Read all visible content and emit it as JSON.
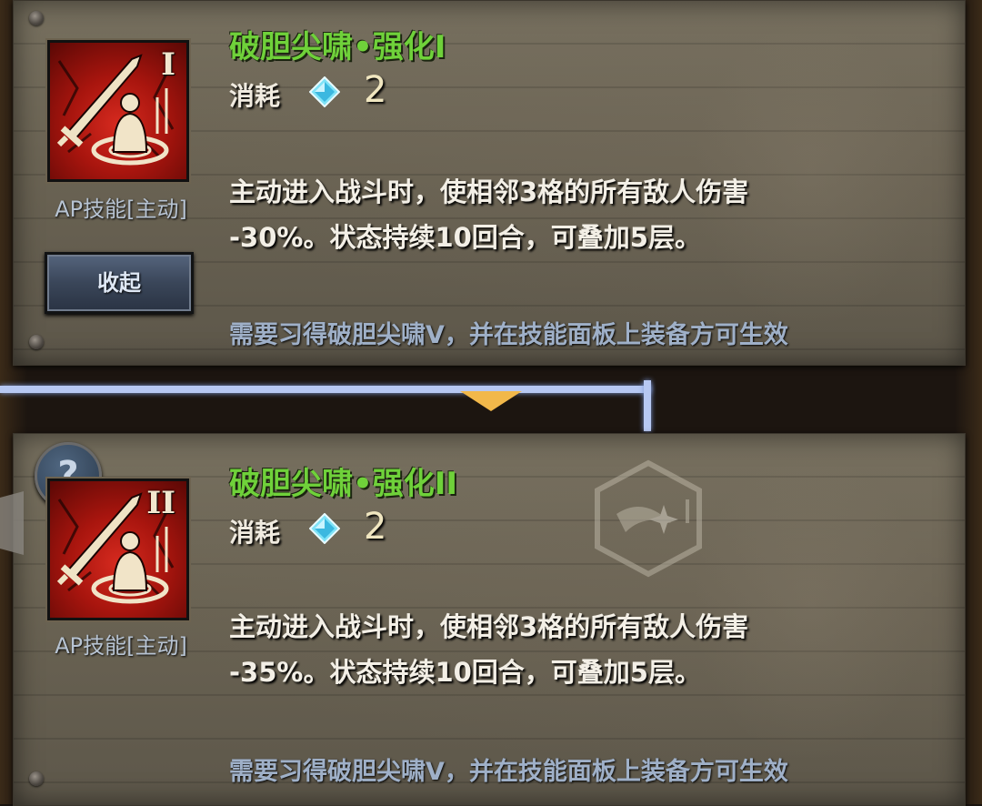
{
  "cards": [
    {
      "title": "破胆尖啸•强化I",
      "level_roman": "I",
      "cost_label": "消耗",
      "cost_value": "2",
      "skill_type": "AP技能[主动]",
      "description_line1": "主动进入战斗时，使相邻3格的所有敌人伤害",
      "description_line2": "-30%。状态持续10回合，可叠加5层。",
      "requirement": "需要习得破胆尖啸V，并在技能面板上装备方可生效",
      "button_label": "收起"
    },
    {
      "title": "破胆尖啸•强化II",
      "level_roman": "II",
      "cost_label": "消耗",
      "cost_value": "2",
      "skill_type": "AP技能[主动]",
      "description_line1": "主动进入战斗时，使相邻3格的所有敌人伤害",
      "description_line2": "-35%。状态持续10回合，可叠加5层。",
      "requirement": "需要习得破胆尖啸V，并在技能面板上装备方可生效",
      "help_symbol": "?"
    }
  ],
  "colors": {
    "title_green": "#6fd13a",
    "connector_blue": "#b7c8f2",
    "pointer_orange": "#f2b84a",
    "gem_cyan": "#7fe3f7"
  },
  "icons": {
    "skill": "sword-shout-icon",
    "cost": "diamond-gem-icon",
    "help": "question-mark-icon",
    "emblem": "star-hexagon-emblem"
  }
}
